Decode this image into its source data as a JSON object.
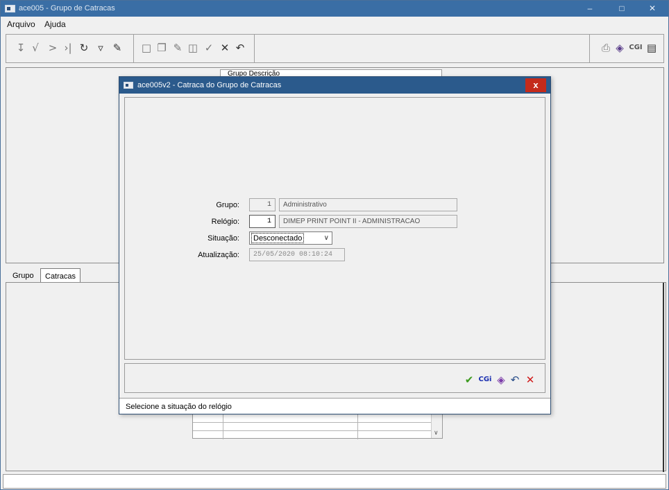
{
  "main_window": {
    "title": "ace005 - Grupo de Catracas",
    "minimize": "–",
    "maximize": "□",
    "close": "✕"
  },
  "menu": {
    "items": [
      "Arquivo",
      "Ajuda"
    ]
  },
  "toolbar": {
    "nav": [
      "first-icon",
      "prev-icon",
      "next-icon",
      "last-icon",
      "refresh-icon",
      "filter-icon",
      "search-icon"
    ],
    "edit": [
      "new-icon",
      "copy-icon",
      "edit-icon",
      "delete-icon",
      "confirm-icon",
      "cancel-icon",
      "undo-icon"
    ],
    "right": [
      "print-icon",
      "report-icon",
      "cgi-icon",
      "exit-icon"
    ],
    "cgi_label": "CGI"
  },
  "grid_header": "Grupo Descrição",
  "tabs": [
    "Grupo",
    "Catracas"
  ],
  "dialog": {
    "title": "ace005v2 - Catraca do Grupo de Catracas",
    "close": "x",
    "fields": {
      "grupo_label": "Grupo:",
      "grupo_code": "1",
      "grupo_desc": "Administrativo",
      "relogio_label": "Relógio:",
      "relogio_code": "1",
      "relogio_desc": "DIMEP PRINT POINT II - ADMINISTRACAO",
      "situacao_label": "Situação:",
      "situacao_value": "Desconectado",
      "atualizacao_label": "Atualização:",
      "atualizacao_value": "25/05/2020 08:10:24"
    },
    "buttons": {
      "confirm": "✔",
      "cgi": "CGi",
      "report": "report-icon",
      "undo": "↶",
      "cancel": "✕"
    },
    "status": "Selecione a situação do relógio"
  }
}
